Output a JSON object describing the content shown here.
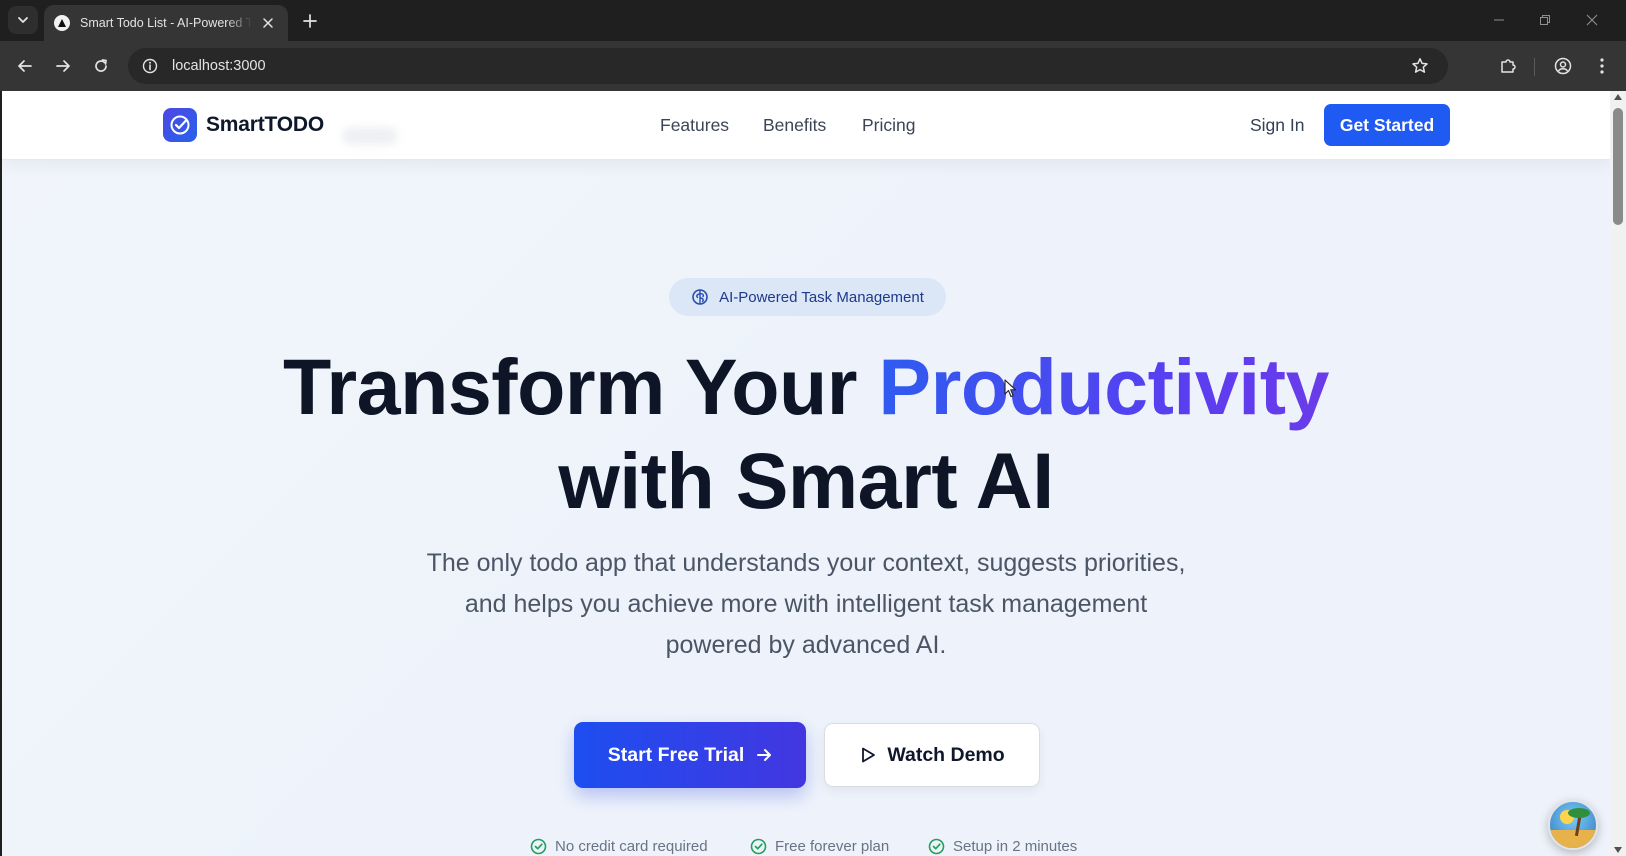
{
  "browser": {
    "tab_title": "Smart Todo List - AI-Powered Task Management",
    "url": "localhost:3000"
  },
  "header": {
    "logo_text": "SmartTODO",
    "nav": [
      "Features",
      "Benefits",
      "Pricing"
    ],
    "sign_in": "Sign In",
    "get_started": "Get Started"
  },
  "hero": {
    "badge": "AI-Powered Task Management",
    "title_part1": "Transform Your ",
    "title_accent": "Productivity",
    "title_line2": "with Smart AI",
    "subtitle": "The only todo app that understands your context, suggests priorities, and helps you achieve more with intelligent task management powered by advanced AI.",
    "primary_cta": "Start Free Trial",
    "secondary_cta": "Watch Demo",
    "perks": [
      "No credit card required",
      "Free forever plan",
      "Setup in 2 minutes"
    ]
  },
  "colors": {
    "primary": "#1f5af2",
    "accent_start": "#2f5bf0",
    "accent_end": "#6b3ce8",
    "check": "#22a05b"
  },
  "icons": {
    "tab_list": "chevron-down-icon",
    "favicon": "triangle-icon",
    "close": "close-icon",
    "new_tab": "plus-icon",
    "back": "arrow-left-icon",
    "forward": "arrow-right-icon",
    "reload": "reload-icon",
    "site_info": "info-icon",
    "bookmark": "star-icon",
    "extensions": "puzzle-icon",
    "profile": "profile-icon",
    "menu": "kebab-menu-icon",
    "logo": "check-circle-icon",
    "badge": "brain-icon",
    "primary_cta": "arrow-right-icon",
    "secondary_cta": "play-icon",
    "perk": "check-circle-icon"
  }
}
